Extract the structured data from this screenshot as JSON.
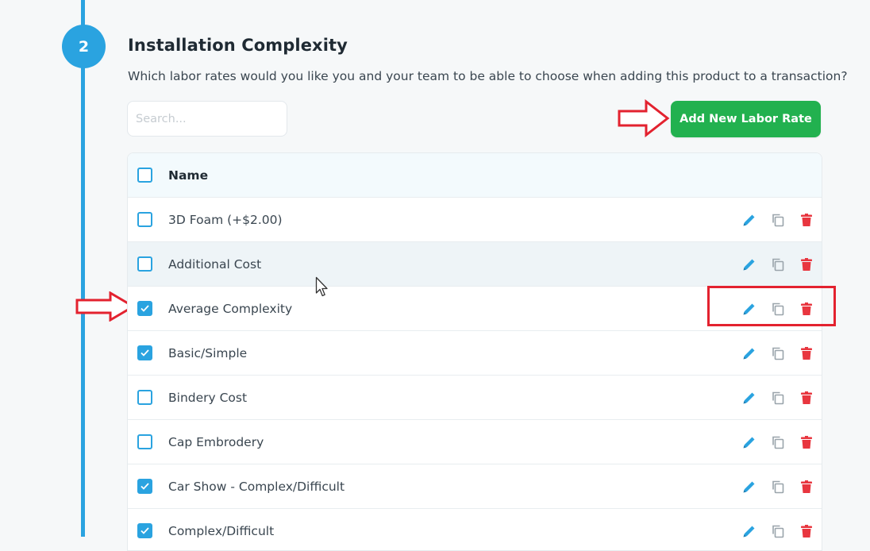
{
  "step": {
    "number": "2",
    "title": "Installation Complexity",
    "description": "Which labor rates would you like you and your team to be able to choose when adding this product to a transaction?"
  },
  "search": {
    "placeholder": "Search...",
    "value": ""
  },
  "add_button": {
    "label": "Add New Labor Rate",
    "color": "#22b14f"
  },
  "table": {
    "header": {
      "name": "Name",
      "checked": false
    },
    "rows": [
      {
        "name": "3D Foam (+$2.00)",
        "checked": false
      },
      {
        "name": "Additional Cost",
        "checked": false
      },
      {
        "name": "Average Complexity",
        "checked": true
      },
      {
        "name": "Basic/Simple",
        "checked": true
      },
      {
        "name": "Bindery Cost",
        "checked": false
      },
      {
        "name": "Cap Embrodery",
        "checked": false
      },
      {
        "name": "Car Show - Complex/Difficult",
        "checked": true
      },
      {
        "name": "Complex/Difficult",
        "checked": true
      }
    ],
    "row_actions": [
      "pencil-icon",
      "copy-icon",
      "trash-icon"
    ]
  },
  "colors": {
    "accent": "#2aa3e0",
    "success": "#22b14f",
    "danger": "#e8363f",
    "annotation": "#e3222f"
  }
}
